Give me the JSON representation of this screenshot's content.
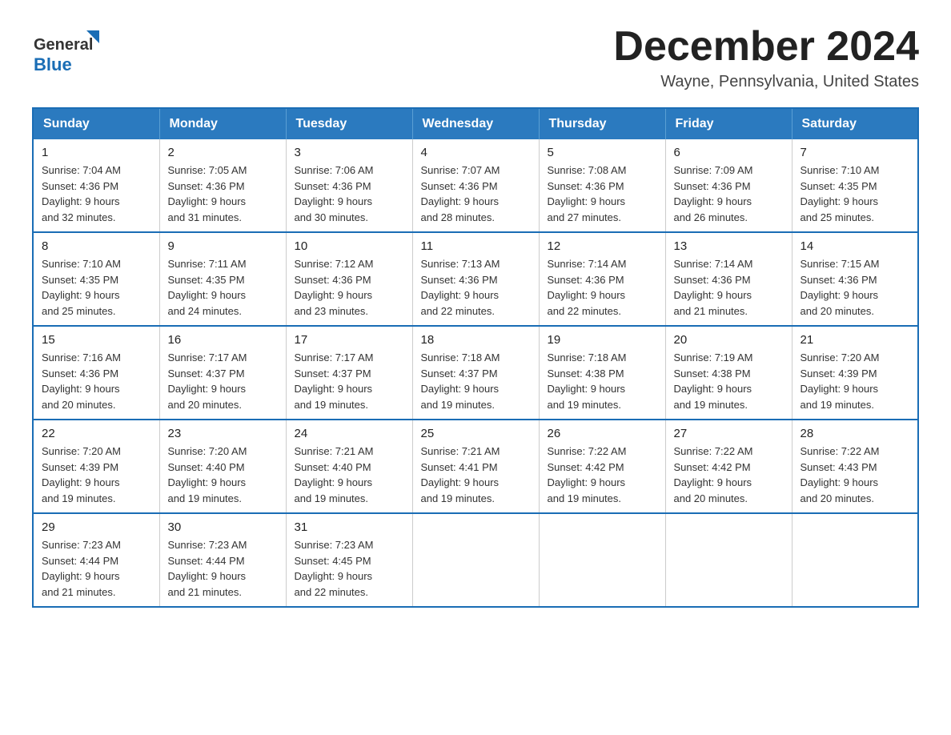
{
  "header": {
    "logo_general": "General",
    "logo_blue": "Blue",
    "main_title": "December 2024",
    "subtitle": "Wayne, Pennsylvania, United States"
  },
  "calendar": {
    "days_of_week": [
      "Sunday",
      "Monday",
      "Tuesday",
      "Wednesday",
      "Thursday",
      "Friday",
      "Saturday"
    ],
    "weeks": [
      [
        {
          "date": "1",
          "sunrise": "7:04 AM",
          "sunset": "4:36 PM",
          "daylight": "9 hours and 32 minutes."
        },
        {
          "date": "2",
          "sunrise": "7:05 AM",
          "sunset": "4:36 PM",
          "daylight": "9 hours and 31 minutes."
        },
        {
          "date": "3",
          "sunrise": "7:06 AM",
          "sunset": "4:36 PM",
          "daylight": "9 hours and 30 minutes."
        },
        {
          "date": "4",
          "sunrise": "7:07 AM",
          "sunset": "4:36 PM",
          "daylight": "9 hours and 28 minutes."
        },
        {
          "date": "5",
          "sunrise": "7:08 AM",
          "sunset": "4:36 PM",
          "daylight": "9 hours and 27 minutes."
        },
        {
          "date": "6",
          "sunrise": "7:09 AM",
          "sunset": "4:36 PM",
          "daylight": "9 hours and 26 minutes."
        },
        {
          "date": "7",
          "sunrise": "7:10 AM",
          "sunset": "4:35 PM",
          "daylight": "9 hours and 25 minutes."
        }
      ],
      [
        {
          "date": "8",
          "sunrise": "7:10 AM",
          "sunset": "4:35 PM",
          "daylight": "9 hours and 25 minutes."
        },
        {
          "date": "9",
          "sunrise": "7:11 AM",
          "sunset": "4:35 PM",
          "daylight": "9 hours and 24 minutes."
        },
        {
          "date": "10",
          "sunrise": "7:12 AM",
          "sunset": "4:36 PM",
          "daylight": "9 hours and 23 minutes."
        },
        {
          "date": "11",
          "sunrise": "7:13 AM",
          "sunset": "4:36 PM",
          "daylight": "9 hours and 22 minutes."
        },
        {
          "date": "12",
          "sunrise": "7:14 AM",
          "sunset": "4:36 PM",
          "daylight": "9 hours and 22 minutes."
        },
        {
          "date": "13",
          "sunrise": "7:14 AM",
          "sunset": "4:36 PM",
          "daylight": "9 hours and 21 minutes."
        },
        {
          "date": "14",
          "sunrise": "7:15 AM",
          "sunset": "4:36 PM",
          "daylight": "9 hours and 20 minutes."
        }
      ],
      [
        {
          "date": "15",
          "sunrise": "7:16 AM",
          "sunset": "4:36 PM",
          "daylight": "9 hours and 20 minutes."
        },
        {
          "date": "16",
          "sunrise": "7:17 AM",
          "sunset": "4:37 PM",
          "daylight": "9 hours and 20 minutes."
        },
        {
          "date": "17",
          "sunrise": "7:17 AM",
          "sunset": "4:37 PM",
          "daylight": "9 hours and 19 minutes."
        },
        {
          "date": "18",
          "sunrise": "7:18 AM",
          "sunset": "4:37 PM",
          "daylight": "9 hours and 19 minutes."
        },
        {
          "date": "19",
          "sunrise": "7:18 AM",
          "sunset": "4:38 PM",
          "daylight": "9 hours and 19 minutes."
        },
        {
          "date": "20",
          "sunrise": "7:19 AM",
          "sunset": "4:38 PM",
          "daylight": "9 hours and 19 minutes."
        },
        {
          "date": "21",
          "sunrise": "7:20 AM",
          "sunset": "4:39 PM",
          "daylight": "9 hours and 19 minutes."
        }
      ],
      [
        {
          "date": "22",
          "sunrise": "7:20 AM",
          "sunset": "4:39 PM",
          "daylight": "9 hours and 19 minutes."
        },
        {
          "date": "23",
          "sunrise": "7:20 AM",
          "sunset": "4:40 PM",
          "daylight": "9 hours and 19 minutes."
        },
        {
          "date": "24",
          "sunrise": "7:21 AM",
          "sunset": "4:40 PM",
          "daylight": "9 hours and 19 minutes."
        },
        {
          "date": "25",
          "sunrise": "7:21 AM",
          "sunset": "4:41 PM",
          "daylight": "9 hours and 19 minutes."
        },
        {
          "date": "26",
          "sunrise": "7:22 AM",
          "sunset": "4:42 PM",
          "daylight": "9 hours and 19 minutes."
        },
        {
          "date": "27",
          "sunrise": "7:22 AM",
          "sunset": "4:42 PM",
          "daylight": "9 hours and 20 minutes."
        },
        {
          "date": "28",
          "sunrise": "7:22 AM",
          "sunset": "4:43 PM",
          "daylight": "9 hours and 20 minutes."
        }
      ],
      [
        {
          "date": "29",
          "sunrise": "7:23 AM",
          "sunset": "4:44 PM",
          "daylight": "9 hours and 21 minutes."
        },
        {
          "date": "30",
          "sunrise": "7:23 AM",
          "sunset": "4:44 PM",
          "daylight": "9 hours and 21 minutes."
        },
        {
          "date": "31",
          "sunrise": "7:23 AM",
          "sunset": "4:45 PM",
          "daylight": "9 hours and 22 minutes."
        },
        null,
        null,
        null,
        null
      ]
    ],
    "label_sunrise": "Sunrise:",
    "label_sunset": "Sunset:",
    "label_daylight": "Daylight:"
  }
}
